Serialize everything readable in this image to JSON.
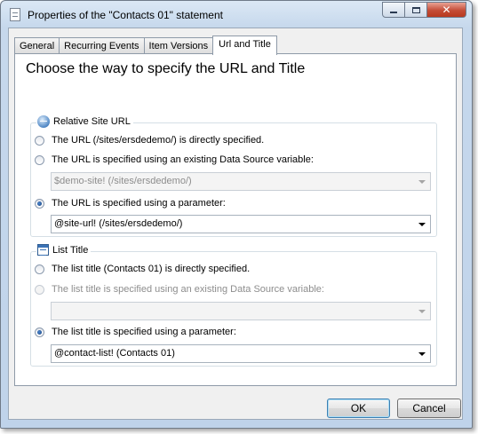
{
  "window": {
    "title": "Properties of the \"Contacts 01\" statement",
    "close_glyph": "✕"
  },
  "tabs": [
    {
      "label": "General"
    },
    {
      "label": "Recurring Events"
    },
    {
      "label": "Item Versions"
    },
    {
      "label": "Url and Title",
      "active": true
    }
  ],
  "panel": {
    "heading": "Choose the way to specify the URL and Title",
    "site_url": {
      "legend": "Relative Site URL",
      "icon": "globe-icon",
      "options": [
        {
          "label": "The URL (/sites/ersdedemo/) is directly specified.",
          "checked": false,
          "enabled": true
        },
        {
          "label": "The URL is specified using an existing Data Source variable:",
          "checked": false,
          "enabled": true
        },
        {
          "label": "The URL is specified using a parameter:",
          "checked": true,
          "enabled": true
        }
      ],
      "variable_combo": {
        "value": "$demo-site! (/sites/ersdedemo/)",
        "enabled": false
      },
      "parameter_combo": {
        "value": "@site-url! (/sites/ersdedemo/)",
        "enabled": true
      }
    },
    "list_title": {
      "legend": "List Title",
      "icon": "list-icon",
      "options": [
        {
          "label": "The list title (Contacts 01) is directly specified.",
          "checked": false,
          "enabled": true
        },
        {
          "label": "The list title is specified using an existing Data Source variable:",
          "checked": false,
          "enabled": false
        },
        {
          "label": "The list title is specified using a parameter:",
          "checked": true,
          "enabled": true
        }
      ],
      "variable_combo": {
        "value": "",
        "enabled": false
      },
      "parameter_combo": {
        "value": "@contact-list! (Contacts 01)",
        "enabled": true
      }
    }
  },
  "buttons": {
    "ok": "OK",
    "cancel": "Cancel"
  }
}
